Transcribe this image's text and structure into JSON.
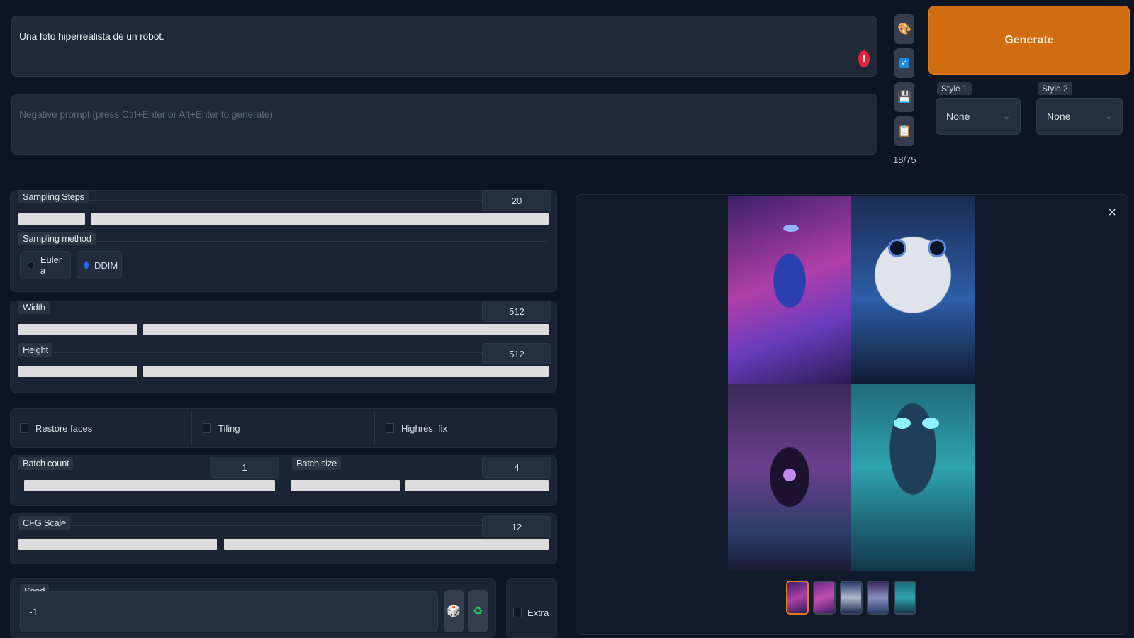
{
  "prompt": {
    "value": "Una foto hiperrealista de un robot.",
    "negative_placeholder": "Negative prompt (press Ctrl+Enter or Alt+Enter to generate)",
    "warning": "!"
  },
  "tools": {
    "token_count": "18/75",
    "icons": [
      "paint-palette-icon",
      "checkbox-icon",
      "floppy-disk-icon",
      "clipboard-icon"
    ]
  },
  "generate_label": "Generate",
  "styles": [
    {
      "label": "Style 1",
      "value": "None"
    },
    {
      "label": "Style 2",
      "value": "None"
    }
  ],
  "sampling": {
    "steps_label": "Sampling Steps",
    "steps_value": "20",
    "steps_fraction": 0.13,
    "method_label": "Sampling method",
    "methods": [
      {
        "label": "Euler a",
        "selected": false
      },
      {
        "label": "DDIM",
        "selected": true
      }
    ]
  },
  "dimensions": {
    "width_label": "Width",
    "width_value": "512",
    "height_label": "Height",
    "height_value": "512"
  },
  "options": [
    {
      "label": "Restore faces",
      "checked": false
    },
    {
      "label": "Tiling",
      "checked": false
    },
    {
      "label": "Highres. fix",
      "checked": false
    }
  ],
  "batch": {
    "count_label": "Batch count",
    "count_value": "1",
    "size_label": "Batch size",
    "size_value": "4"
  },
  "cfg": {
    "label": "CFG Scale",
    "value": "12"
  },
  "seed": {
    "label": "Seed",
    "value": "-1",
    "extra_label": "Extra",
    "icons": [
      "dice-icon",
      "recycle-icon"
    ]
  },
  "gallery": {
    "close": "×"
  }
}
